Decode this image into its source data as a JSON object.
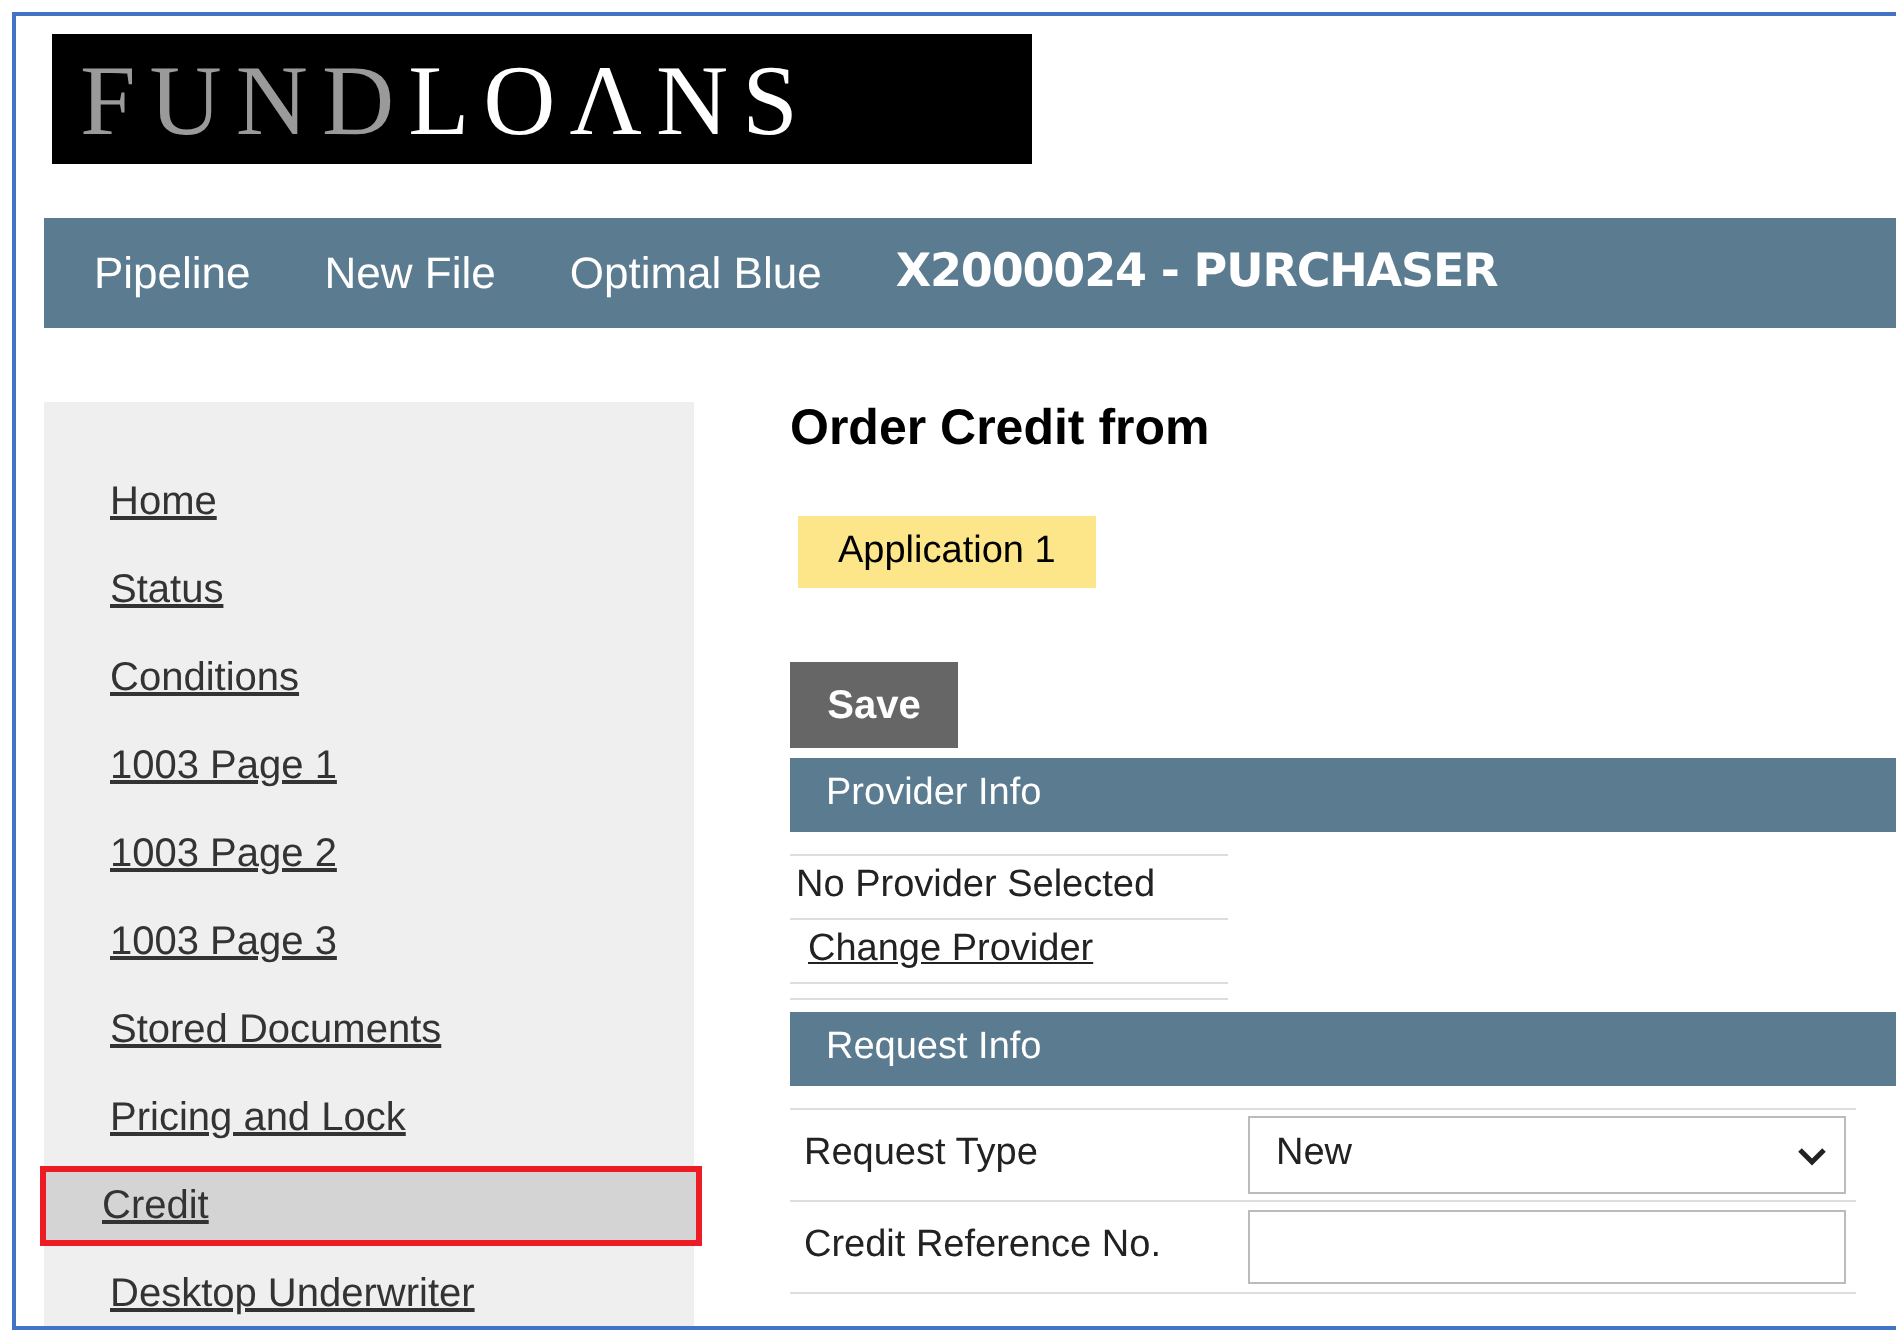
{
  "logo": {
    "dim_part": "FUND",
    "bright_part": "LOΛNS"
  },
  "nav": [
    {
      "label": "Pipeline",
      "kind": "link"
    },
    {
      "label": "New File",
      "kind": "link"
    },
    {
      "label": "Optimal Blue",
      "kind": "link"
    },
    {
      "label": "X2000024 - PURCHASER",
      "kind": "file"
    }
  ],
  "sidebar": {
    "items": [
      {
        "label": "Home",
        "selected": false
      },
      {
        "label": "Status",
        "selected": false
      },
      {
        "label": "Conditions",
        "selected": false
      },
      {
        "label": "1003 Page 1",
        "selected": false
      },
      {
        "label": "1003 Page 2",
        "selected": false
      },
      {
        "label": "1003 Page 3",
        "selected": false
      },
      {
        "label": "Stored Documents",
        "selected": false
      },
      {
        "label": "Pricing and Lock",
        "selected": false
      },
      {
        "label": "Credit",
        "selected": true
      },
      {
        "label": "Desktop Underwriter",
        "selected": false
      }
    ]
  },
  "title": "Order Credit from",
  "tabs": [
    {
      "label": "Application 1",
      "selected": true
    }
  ],
  "save_button": "Save",
  "provider_info": {
    "header": "Provider Info",
    "status": "No Provider Selected",
    "link": "Change Provider"
  },
  "request_info": {
    "header": "Request Info",
    "fields": [
      {
        "label": "Request Type",
        "kind": "select",
        "value": "New"
      },
      {
        "label": "Credit Reference No.",
        "kind": "text"
      }
    ]
  }
}
